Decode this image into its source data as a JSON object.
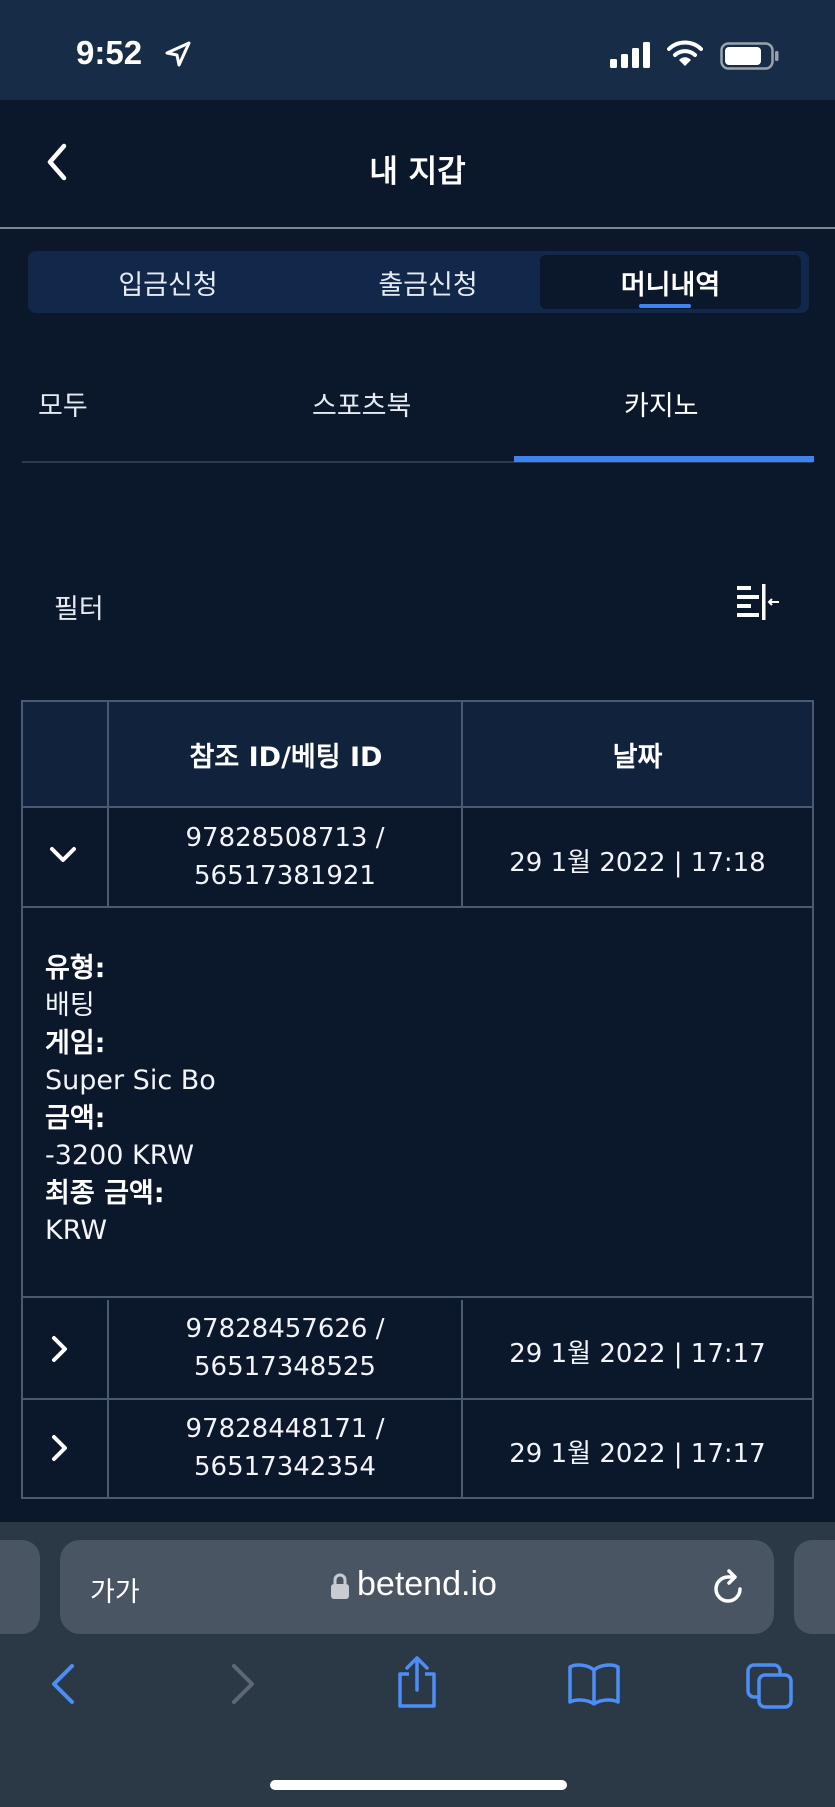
{
  "status_bar": {
    "time": "9:52"
  },
  "header": {
    "title": "내 지갑"
  },
  "main_tabs": [
    {
      "label": "입금신청",
      "active": false
    },
    {
      "label": "출금신청",
      "active": false
    },
    {
      "label": "머니내역",
      "active": true
    }
  ],
  "sub_tabs": [
    {
      "label": "모두",
      "active": false
    },
    {
      "label": "스포츠북",
      "active": false
    },
    {
      "label": "카지노",
      "active": true
    }
  ],
  "filter": {
    "label": "필터",
    "icon": "filter-collapse-icon"
  },
  "table": {
    "columns": [
      "",
      "참조 ID/베팅 ID",
      "날짜"
    ],
    "rows": [
      {
        "expanded": true,
        "ref_line1": "97828508713 /",
        "ref_line2": "56517381921",
        "date": "29 1월 2022 | 17:18",
        "details": {
          "type_label": "유형:",
          "type_value": "배팅",
          "game_label": "게임:",
          "game_value": "Super Sic Bo",
          "amount_label": "금액:",
          "amount_value": "-3200 KRW",
          "final_label": "최종 금액:",
          "final_value": "KRW"
        }
      },
      {
        "expanded": false,
        "ref_line1": "97828457626 /",
        "ref_line2": "56517348525",
        "date": "29 1월 2022 | 17:17"
      },
      {
        "expanded": false,
        "ref_line1": "97828448171 /",
        "ref_line2": "56517342354",
        "date": "29 1월 2022 | 17:17"
      }
    ]
  },
  "browser": {
    "text_size_label": "가가",
    "url": "betend.io"
  },
  "colors": {
    "background": "#0b172a",
    "accent": "#3d84f1",
    "tab_bar": "#12284a",
    "browser_bar": "#2b3846"
  }
}
